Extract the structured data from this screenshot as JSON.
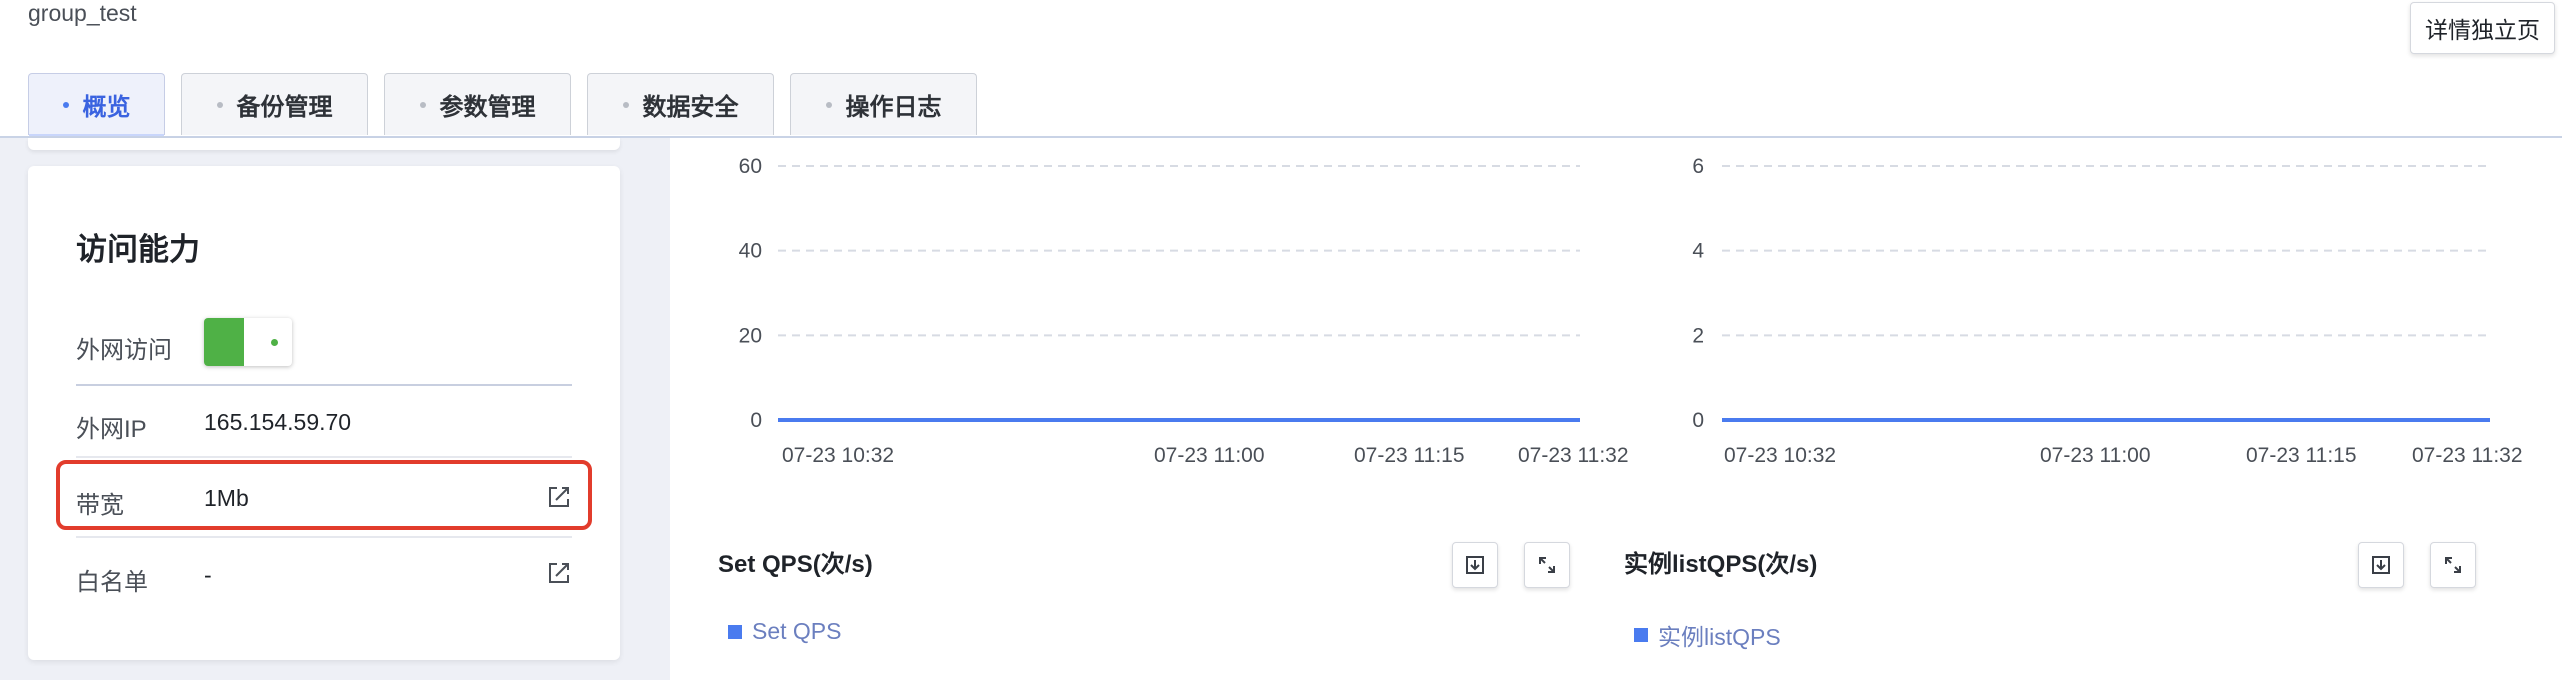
{
  "header": {
    "group_title": "group_test",
    "detail_button": "详情独立页"
  },
  "tabs": [
    {
      "label": "概览",
      "active": true
    },
    {
      "label": "备份管理",
      "active": false
    },
    {
      "label": "参数管理",
      "active": false
    },
    {
      "label": "数据安全",
      "active": false
    },
    {
      "label": "操作日志",
      "active": false
    }
  ],
  "access": {
    "title": "访问能力",
    "rows": [
      {
        "label": "外网访问",
        "toggle_on": true
      },
      {
        "label": "外网IP",
        "value": "165.154.59.70"
      },
      {
        "label": "带宽",
        "value": "1Mb",
        "icon": "edit-icon"
      },
      {
        "label": "白名单",
        "value": "-",
        "icon": "edit-icon"
      }
    ]
  },
  "colors": {
    "accent": "#4a7bef",
    "toggle_on": "#4fb146",
    "highlight": "#e23c2c"
  },
  "chart_data": [
    {
      "type": "line",
      "x": [
        "07-23 10:32",
        "07-23 11:00",
        "07-23 11:15",
        "07-23 11:32"
      ],
      "yticks": [
        0,
        20,
        40,
        60
      ],
      "ylim": [
        0,
        60
      ],
      "series": [
        {
          "name": "Set QPS",
          "values": [
            0,
            0,
            0,
            0
          ]
        }
      ],
      "grid": true,
      "title": "Set QPS(次/s)"
    },
    {
      "type": "line",
      "x": [
        "07-23 10:32",
        "07-23 11:00",
        "07-23 11:15",
        "07-23 11:32"
      ],
      "yticks": [
        0,
        2,
        4,
        6
      ],
      "ylim": [
        0,
        6
      ],
      "series": [
        {
          "name": "实例listQPS",
          "values": [
            0,
            0,
            0,
            0
          ]
        }
      ],
      "grid": true,
      "title": "实例listQPS(次/s)"
    }
  ]
}
